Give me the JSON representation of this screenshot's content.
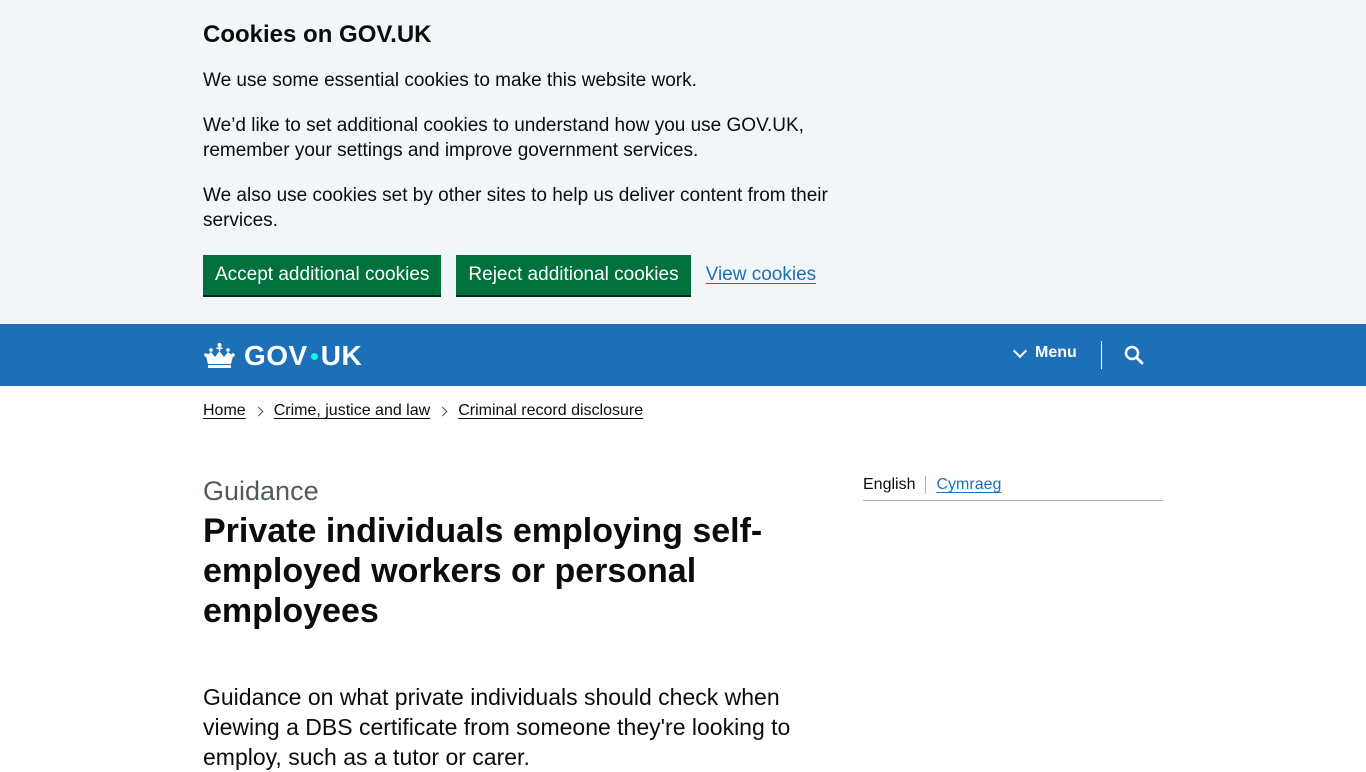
{
  "cookie_banner": {
    "title": "Cookies on GOV.UK",
    "paragraphs": [
      "We use some essential cookies to make this website work.",
      "We’d like to set additional cookies to understand how you use GOV.UK, remember your settings and improve government services.",
      "We also use cookies set by other sites to help us deliver content from their services."
    ],
    "accept_label": "Accept additional cookies",
    "reject_label": "Reject additional cookies",
    "view_label": "View cookies"
  },
  "header": {
    "logo_gov": "GOV",
    "logo_uk": "UK",
    "menu_label": "Menu",
    "colors": {
      "background": "#1d70b8",
      "dot": "#00ffe0"
    }
  },
  "breadcrumbs": [
    "Home",
    "Crime, justice and law",
    "Criminal record disclosure"
  ],
  "main": {
    "caption": "Guidance",
    "title": "Private individuals employing self-employed workers or personal employees",
    "lede": "Guidance on what private individuals should check when viewing a DBS certificate from someone they're looking to employ, such as a tutor or carer."
  },
  "language": {
    "current": "English",
    "alternate": "Cymraeg"
  },
  "colors": {
    "banner_bg": "#f3f6f9",
    "button_green": "#00703c",
    "link_blue": "#1d70b8",
    "caption_grey": "#505a5f"
  }
}
